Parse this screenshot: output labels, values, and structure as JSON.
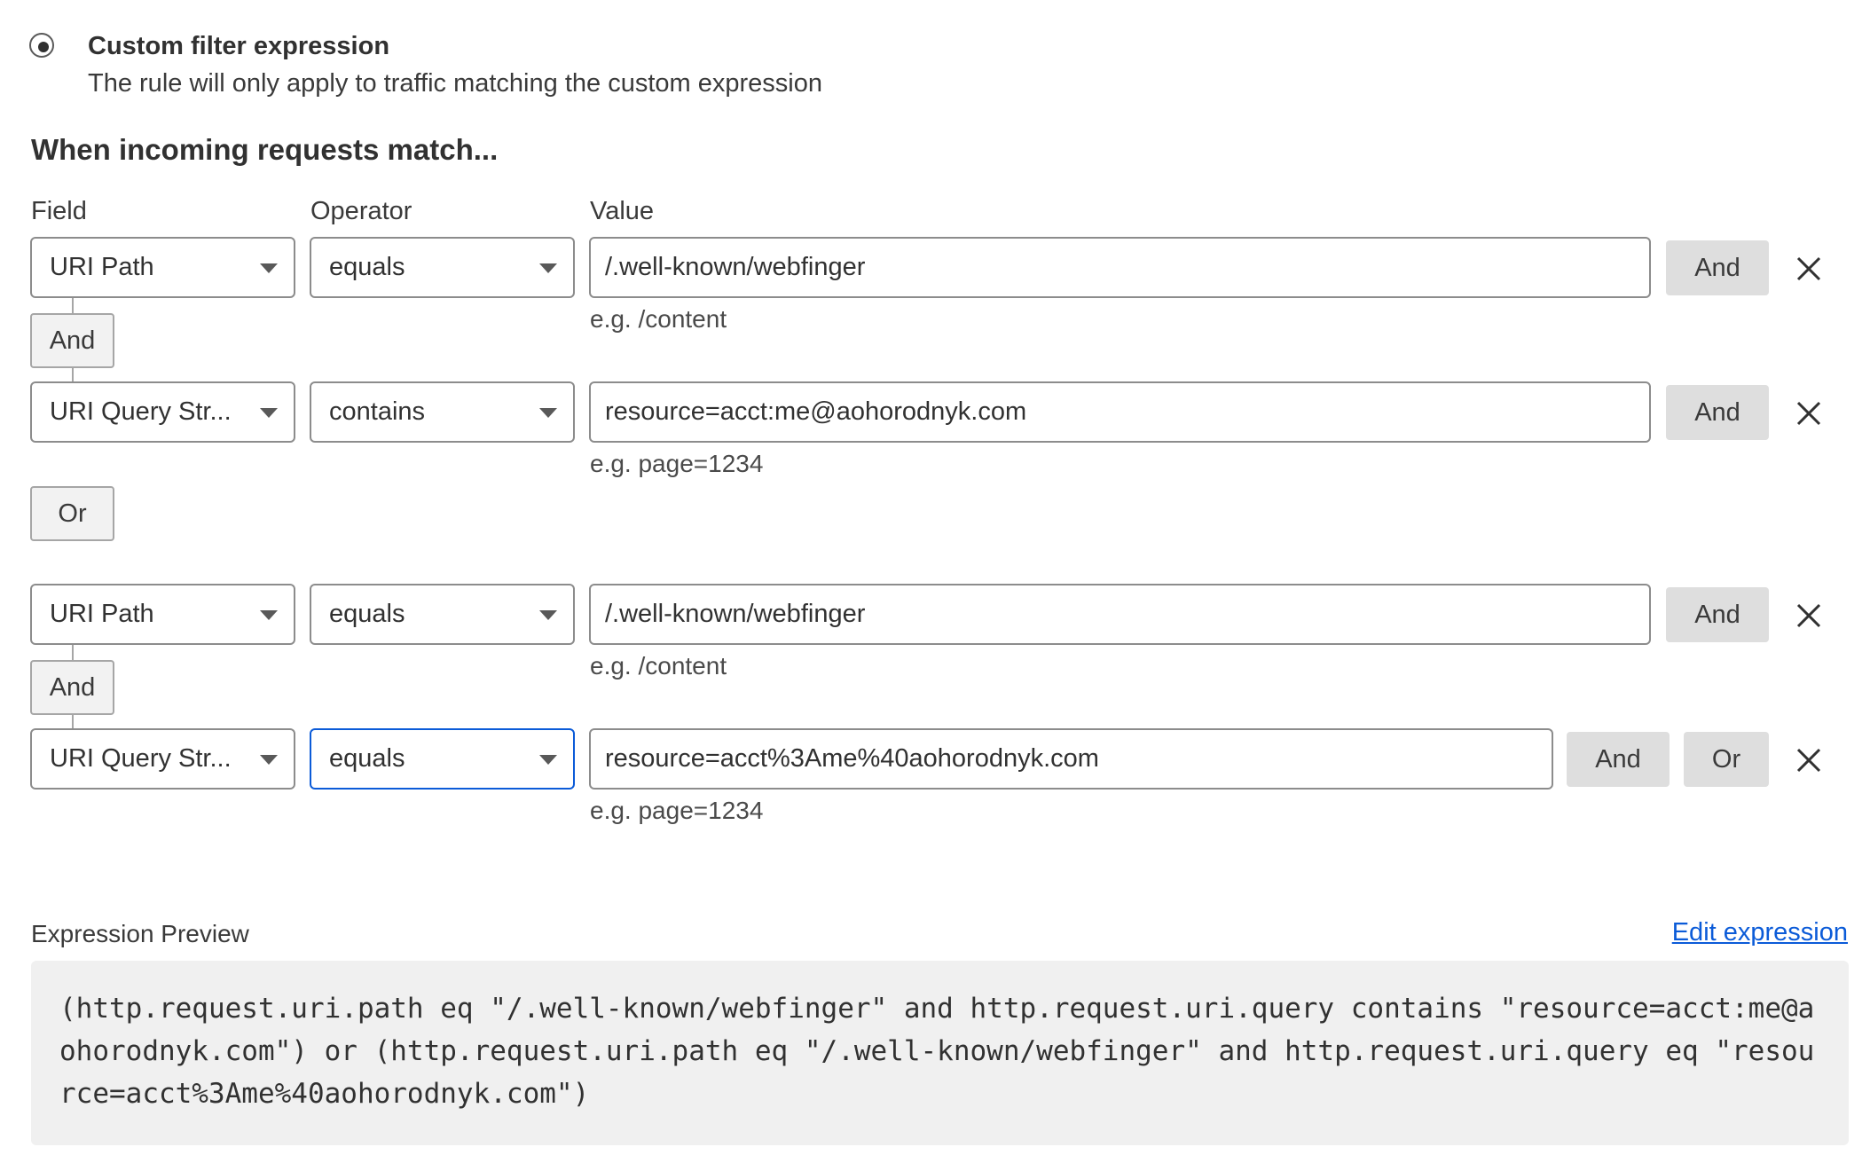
{
  "filter_option": {
    "title": "Custom filter expression",
    "description": "The rule will only apply to traffic matching the custom expression"
  },
  "heading": "When incoming requests match...",
  "columns": {
    "field": "Field",
    "operator": "Operator",
    "value": "Value"
  },
  "rows": [
    {
      "field": "URI Path",
      "operator": "equals",
      "value": "/.well-known/webfinger",
      "hint": "e.g. /content"
    },
    {
      "field": "URI Query Str...",
      "operator": "contains",
      "value": "resource=acct:me@aohorodnyk.com",
      "hint": "e.g. page=1234"
    },
    {
      "field": "URI Path",
      "operator": "equals",
      "value": "/.well-known/webfinger",
      "hint": "e.g. /content"
    },
    {
      "field": "URI Query Str...",
      "operator": "equals",
      "value": "resource=acct%3Ame%40aohorodnyk.com",
      "hint": "e.g. page=1234"
    }
  ],
  "buttons": {
    "and": "And",
    "or": "Or"
  },
  "preview": {
    "label": "Expression Preview",
    "edit_link": "Edit expression",
    "expression": "(http.request.uri.path eq \"/.well-known/webfinger\" and http.request.uri.query contains \"resource=acct:me@aohorodnyk.com\") or (http.request.uri.path eq \"/.well-known/webfinger\" and http.request.uri.query eq \"resource=acct%3Ame%40aohorodnyk.com\")"
  },
  "icons": {
    "radio": "radio-selected-icon",
    "caret": "caret-down-icon",
    "remove": "close-icon"
  },
  "colors": {
    "accent": "#0b5bd8",
    "button_gray": "#dedede",
    "preview_bg": "#f0f0f0"
  }
}
